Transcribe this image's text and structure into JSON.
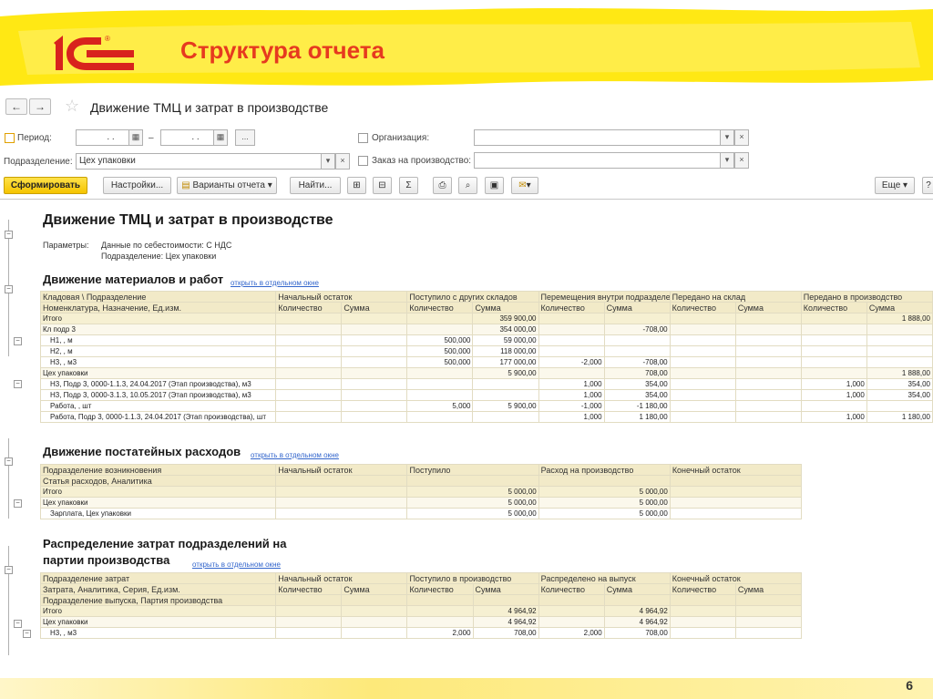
{
  "slide": {
    "title": "Структура отчета",
    "logo_text": "1С",
    "page_number": "6"
  },
  "toolbar": {
    "back_icon": "arrow-left-icon",
    "forward_icon": "arrow-right-icon",
    "window_title": "Движение ТМЦ и затрат в производстве"
  },
  "filters": {
    "period_label": "Период:",
    "period_from": ". .",
    "period_dash": "–",
    "period_to": ". .",
    "period_more": "...",
    "department_label": "Подразделение:",
    "department_value": "Цех упаковки",
    "organization_label": "Организация:",
    "order_label": "Заказ на производство:"
  },
  "buttons": {
    "generate": "Сформировать",
    "settings": "Настройки...",
    "variants": "Варианты отчета",
    "find": "Найти...",
    "more": "Еще",
    "sum": "Σ"
  },
  "report": {
    "title": "Движение ТМЦ и затрат в производстве",
    "params_label": "Параметры:",
    "param1": "Данные по себестоимости: С НДС",
    "param2": "Подразделение: Цех упаковки",
    "open_link": "открыть в отдельном окне",
    "s1": {
      "title": "Движение материалов и работ",
      "h1": [
        "Кладовая \\ Подразделение",
        "Начальный остаток",
        "Поступило с других складов",
        "Перемещения внутри подразделения",
        "Передано на склад",
        "Передано в производство"
      ],
      "h2": [
        "Номенклатура, Назначение, Ед.изм.",
        "Количество",
        "Сумма",
        "Количество",
        "Сумма",
        "Количество",
        "Сумма",
        "Количество",
        "Сумма",
        "Количество",
        "Сумма"
      ],
      "rows": [
        [
          "Итого",
          "",
          "",
          "",
          "359 900,00",
          "",
          "",
          "",
          "",
          "",
          "1 888,00"
        ],
        [
          "Кл подр 3",
          "",
          "",
          "",
          "354 000,00",
          "",
          "-708,00",
          "",
          "",
          "",
          ""
        ],
        [
          "Н1, , м",
          "",
          "",
          "500,000",
          "59 000,00",
          "",
          "",
          "",
          "",
          "",
          ""
        ],
        [
          "Н2, , м",
          "",
          "",
          "500,000",
          "118 000,00",
          "",
          "",
          "",
          "",
          "",
          ""
        ],
        [
          "Н3, , м3",
          "",
          "",
          "500,000",
          "177 000,00",
          "-2,000",
          "-708,00",
          "",
          "",
          "",
          ""
        ],
        [
          "Цех упаковки",
          "",
          "",
          "",
          "5 900,00",
          "",
          "708,00",
          "",
          "",
          "",
          "1 888,00"
        ],
        [
          "Н3, Подр 3, 0000-1.1.3, 24.04.2017 (Этап производства), м3",
          "",
          "",
          "",
          "",
          "1,000",
          "354,00",
          "",
          "",
          "1,000",
          "354,00"
        ],
        [
          "Н3, Подр 3, 0000-3.1.3, 10.05.2017 (Этап производства), м3",
          "",
          "",
          "",
          "",
          "1,000",
          "354,00",
          "",
          "",
          "1,000",
          "354,00"
        ],
        [
          "Работа, , шт",
          "",
          "",
          "5,000",
          "5 900,00",
          "-1,000",
          "-1 180,00",
          "",
          "",
          "",
          ""
        ],
        [
          "Работа, Подр 3, 0000-1.1.3, 24.04.2017 (Этап производства), шт",
          "",
          "",
          "",
          "",
          "1,000",
          "1 180,00",
          "",
          "",
          "1,000",
          "1 180,00"
        ]
      ]
    },
    "s2": {
      "title": "Движение постатейных расходов",
      "h1": [
        "Подразделение возникновения",
        "Начальный остаток",
        "Поступило",
        "Расход на производство",
        "Конечный остаток"
      ],
      "h2": [
        "Статья расходов, Аналитика"
      ],
      "rows": [
        [
          "Итого",
          "",
          "5 000,00",
          "5 000,00",
          ""
        ],
        [
          "Цех упаковки",
          "",
          "5 000,00",
          "5 000,00",
          ""
        ],
        [
          "Зарплата, Цех упаковки",
          "",
          "5 000,00",
          "5 000,00",
          ""
        ]
      ]
    },
    "s3": {
      "title_line1": "Распределение затрат подразделений на",
      "title_line2": "партии производства",
      "h1": [
        "Подразделение затрат",
        "Начальный остаток",
        "Поступило в производство",
        "Распределено на выпуск",
        "Конечный остаток"
      ],
      "h2": [
        "Затрата, Аналитика, Серия, Ед.изм.",
        "Количество",
        "Сумма",
        "Количество",
        "Сумма",
        "Количество",
        "Сумма",
        "Количество",
        "Сумма"
      ],
      "h3": [
        "Подразделение выпуска, Партия производства"
      ],
      "rows": [
        [
          "Итого",
          "",
          "",
          "",
          "4 964,92",
          "",
          "4 964,92",
          "",
          ""
        ],
        [
          "Цех упаковки",
          "",
          "",
          "",
          "4 964,92",
          "",
          "4 964,92",
          "",
          ""
        ],
        [
          "Н3, , м3",
          "",
          "",
          "2,000",
          "708,00",
          "2,000",
          "708,00",
          "",
          ""
        ]
      ]
    }
  }
}
